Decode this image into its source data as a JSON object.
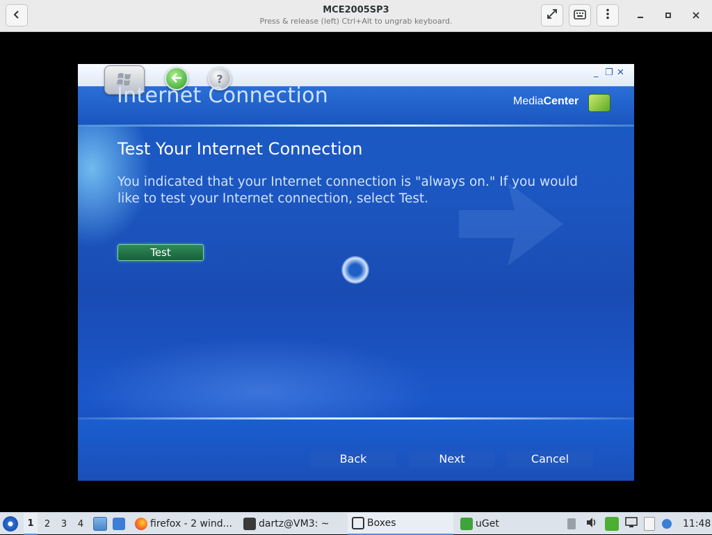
{
  "boxes": {
    "title": "MCE2005SP3",
    "subtitle": "Press & release (left) Ctrl+Alt to ungrab keyboard.",
    "icons": {
      "back": "chevron-left-icon",
      "fullscreen": "fullscreen-icon",
      "keyboard": "keyboard-icon",
      "menu": "kebab-menu-icon",
      "minimize": "minimize-icon",
      "maximize": "maximize-icon",
      "close": "close-icon"
    }
  },
  "media_center": {
    "page_title": "Internet Connection",
    "logo_text_light": "Media",
    "logo_text_bold": "Center",
    "heading": "Test Your Internet Connection",
    "body_line1": "You indicated that your Internet connection is \"always on.\" If you would",
    "body_line2": "like to test your Internet connection, select Test.",
    "test_label": "Test",
    "nav": {
      "back": "Back",
      "next": "Next",
      "cancel": "Cancel"
    },
    "window_controls": {
      "minimize": "_",
      "restore": "❐",
      "close": "✕"
    },
    "accent_color": "#1a57c1",
    "button_green": "#1f7a4a"
  },
  "taskbar": {
    "workspaces": [
      "1",
      "2",
      "3",
      "4"
    ],
    "tasks": [
      {
        "label": "firefox - 2 wind...",
        "icon": "firefox-icon"
      },
      {
        "label": "dartz@VM3: ~",
        "icon": "terminal-icon"
      },
      {
        "label": "Boxes",
        "icon": "boxes-icon"
      },
      {
        "label": "uGet",
        "icon": "uget-icon"
      }
    ],
    "clock": "11:48"
  }
}
